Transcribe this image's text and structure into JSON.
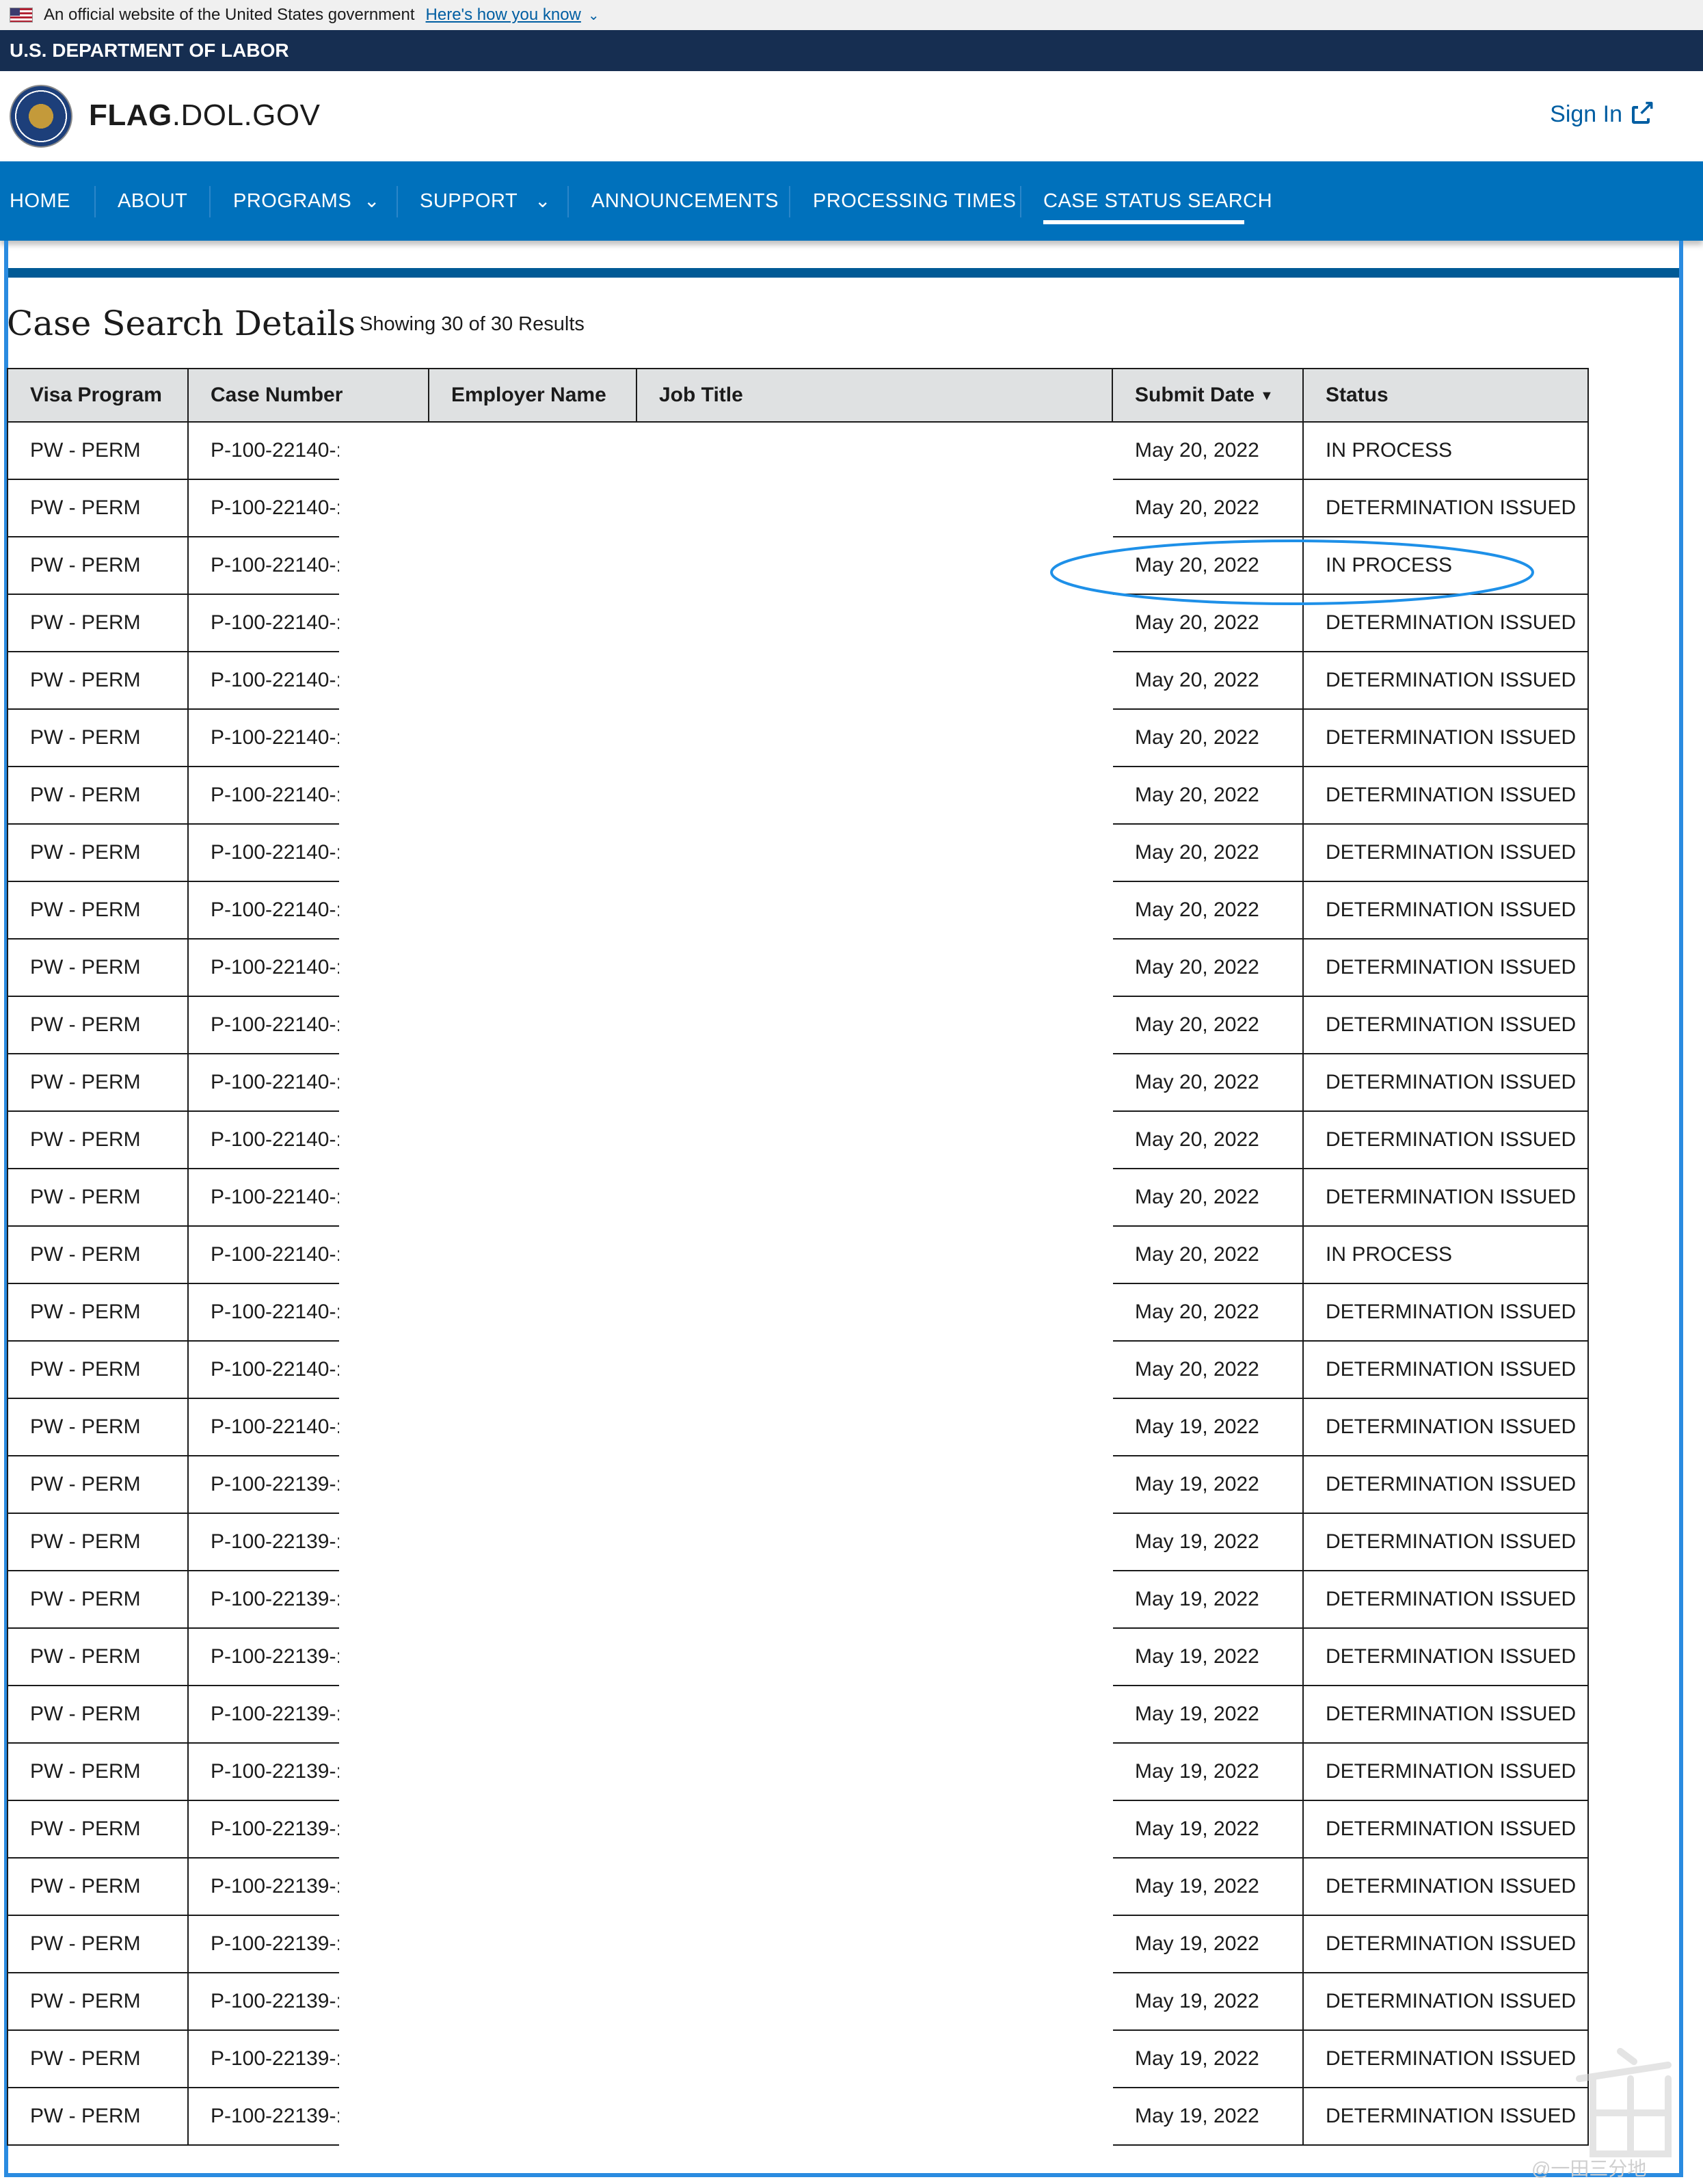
{
  "gov_banner": {
    "text": "An official website of the United States government",
    "link": "Here's how you know"
  },
  "department": "U.S. DEPARTMENT OF LABOR",
  "site": {
    "title_bold": "FLAG",
    "title_rest": ".DOL.GOV",
    "sign_in": "Sign In"
  },
  "nav": {
    "items": [
      "HOME",
      "ABOUT",
      "PROGRAMS",
      "SUPPORT",
      "ANNOUNCEMENTS",
      "PROCESSING TIMES",
      "CASE STATUS SEARCH"
    ],
    "active": "CASE STATUS SEARCH"
  },
  "page": {
    "title": "Case Search Details",
    "result_count": "Showing 30 of 30 Results"
  },
  "table": {
    "headers": [
      "Visa Program",
      "Case Number",
      "Employer Name",
      "Job Title",
      "Submit Date",
      "Status"
    ],
    "rows": [
      {
        "program": "PW - PERM",
        "case": "P-100-22140-:",
        "date": "May 20, 2022",
        "status": "IN PROCESS"
      },
      {
        "program": "PW - PERM",
        "case": "P-100-22140-:",
        "date": "May 20, 2022",
        "status": "DETERMINATION ISSUED"
      },
      {
        "program": "PW - PERM",
        "case": "P-100-22140-:",
        "date": "May 20, 2022",
        "status": "IN PROCESS"
      },
      {
        "program": "PW - PERM",
        "case": "P-100-22140-:",
        "date": "May 20, 2022",
        "status": "DETERMINATION ISSUED"
      },
      {
        "program": "PW - PERM",
        "case": "P-100-22140-:",
        "date": "May 20, 2022",
        "status": "DETERMINATION ISSUED"
      },
      {
        "program": "PW - PERM",
        "case": "P-100-22140-:",
        "date": "May 20, 2022",
        "status": "DETERMINATION ISSUED"
      },
      {
        "program": "PW - PERM",
        "case": "P-100-22140-:",
        "date": "May 20, 2022",
        "status": "DETERMINATION ISSUED"
      },
      {
        "program": "PW - PERM",
        "case": "P-100-22140-:",
        "date": "May 20, 2022",
        "status": "DETERMINATION ISSUED"
      },
      {
        "program": "PW - PERM",
        "case": "P-100-22140-:",
        "date": "May 20, 2022",
        "status": "DETERMINATION ISSUED"
      },
      {
        "program": "PW - PERM",
        "case": "P-100-22140-:",
        "date": "May 20, 2022",
        "status": "DETERMINATION ISSUED"
      },
      {
        "program": "PW - PERM",
        "case": "P-100-22140-:",
        "date": "May 20, 2022",
        "status": "DETERMINATION ISSUED"
      },
      {
        "program": "PW - PERM",
        "case": "P-100-22140-:",
        "date": "May 20, 2022",
        "status": "DETERMINATION ISSUED"
      },
      {
        "program": "PW - PERM",
        "case": "P-100-22140-:",
        "date": "May 20, 2022",
        "status": "DETERMINATION ISSUED"
      },
      {
        "program": "PW - PERM",
        "case": "P-100-22140-:",
        "date": "May 20, 2022",
        "status": "DETERMINATION ISSUED"
      },
      {
        "program": "PW - PERM",
        "case": "P-100-22140-:",
        "date": "May 20, 2022",
        "status": "IN PROCESS"
      },
      {
        "program": "PW - PERM",
        "case": "P-100-22140-:",
        "date": "May 20, 2022",
        "status": "DETERMINATION ISSUED"
      },
      {
        "program": "PW - PERM",
        "case": "P-100-22140-:",
        "date": "May 20, 2022",
        "status": "DETERMINATION ISSUED"
      },
      {
        "program": "PW - PERM",
        "case": "P-100-22140-:",
        "date": "May 19, 2022",
        "status": "DETERMINATION ISSUED"
      },
      {
        "program": "PW - PERM",
        "case": "P-100-22139-:",
        "date": "May 19, 2022",
        "status": "DETERMINATION ISSUED"
      },
      {
        "program": "PW - PERM",
        "case": "P-100-22139-:",
        "date": "May 19, 2022",
        "status": "DETERMINATION ISSUED"
      },
      {
        "program": "PW - PERM",
        "case": "P-100-22139-:",
        "date": "May 19, 2022",
        "status": "DETERMINATION ISSUED"
      },
      {
        "program": "PW - PERM",
        "case": "P-100-22139-:",
        "date": "May 19, 2022",
        "status": "DETERMINATION ISSUED"
      },
      {
        "program": "PW - PERM",
        "case": "P-100-22139-:",
        "date": "May 19, 2022",
        "status": "DETERMINATION ISSUED"
      },
      {
        "program": "PW - PERM",
        "case": "P-100-22139-:",
        "date": "May 19, 2022",
        "status": "DETERMINATION ISSUED"
      },
      {
        "program": "PW - PERM",
        "case": "P-100-22139-:",
        "date": "May 19, 2022",
        "status": "DETERMINATION ISSUED"
      },
      {
        "program": "PW - PERM",
        "case": "P-100-22139-:",
        "date": "May 19, 2022",
        "status": "DETERMINATION ISSUED"
      },
      {
        "program": "PW - PERM",
        "case": "P-100-22139-:",
        "date": "May 19, 2022",
        "status": "DETERMINATION ISSUED"
      },
      {
        "program": "PW - PERM",
        "case": "P-100-22139-:",
        "date": "May 19, 2022",
        "status": "DETERMINATION ISSUED"
      },
      {
        "program": "PW - PERM",
        "case": "P-100-22139-:",
        "date": "May 19, 2022",
        "status": "DETERMINATION ISSUED"
      },
      {
        "program": "PW - PERM",
        "case": "P-100-22139-:",
        "date": "May 19, 2022",
        "status": "DETERMINATION ISSUED"
      }
    ]
  },
  "watermark": "@一田三分地",
  "colors": {
    "dept_bar": "#162e51",
    "nav": "#0071bc",
    "link": "#005ea2",
    "annotation": "#1e90e8"
  }
}
